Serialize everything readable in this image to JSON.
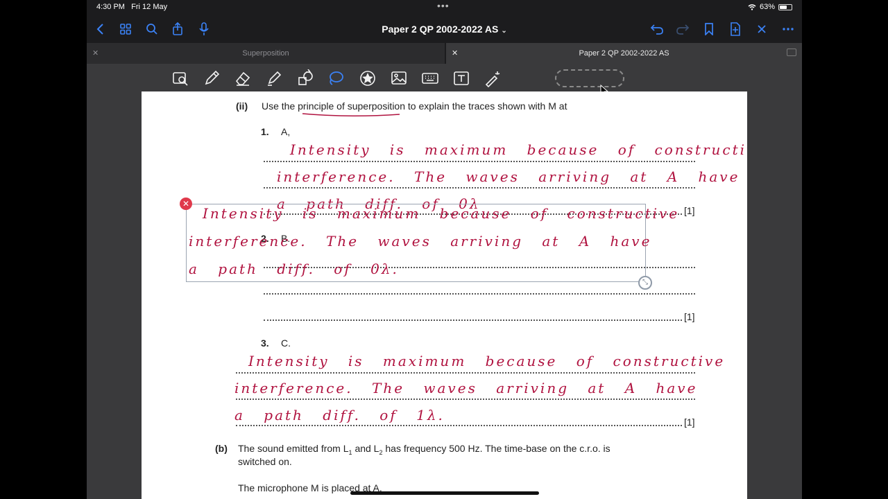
{
  "status": {
    "time": "4:30 PM",
    "date": "Fri 12 May",
    "battery": "63%",
    "battery_level": 0.63
  },
  "nav": {
    "title": "Paper 2 QP 2002-2022 AS"
  },
  "tabs": [
    {
      "label": "Superposition"
    },
    {
      "label": "Paper 2 QP 2002-2022 AS"
    }
  ],
  "doc": {
    "q_ii_label": "(ii)",
    "q_ii_text": "Use the principle of superposition to explain the traces shown with M at",
    "items": [
      {
        "num": "1.",
        "letter": "A,"
      },
      {
        "num": "2.",
        "letter": "B."
      },
      {
        "num": "3.",
        "letter": "C."
      }
    ],
    "mark": "[1]",
    "b_label": "(b)",
    "b_text_1_pre": "The sound emitted from L",
    "b_sub1": "1",
    "b_and": "and L",
    "b_sub2": "2",
    "b_text_1_post": "has frequency 500 Hz. The time-base on the c.r.o. is",
    "b_text_2": "switched on.",
    "b_text_3": "The microphone M is placed at A."
  },
  "handwriting": {
    "ans1": [
      "Intensity is maximum because of constructive",
      "interference. The waves arriving at A have",
      "a path diff. of 0λ"
    ],
    "sel": [
      "Intensity is maximum because of constructive",
      "interference. The waves arriving at A have",
      "a path diff. of 0λ."
    ],
    "ans3": [
      "Intensity is maximum because of constructive",
      "interference. The waves arriving at A have",
      "a path diff. of 1λ."
    ]
  },
  "icons": {
    "back": "chevron-left-icon",
    "grid": "grid-icon",
    "search": "search-icon",
    "share": "share-icon",
    "mic": "microphone-icon",
    "undo": "undo-icon",
    "redo": "redo-icon",
    "bookmark": "bookmark-icon",
    "add_page": "add-page-icon",
    "close": "close-icon",
    "more": "more-icon"
  },
  "colors": {
    "accent": "#3b82f6",
    "ink": "#b0123f",
    "delete": "#e0394b"
  }
}
